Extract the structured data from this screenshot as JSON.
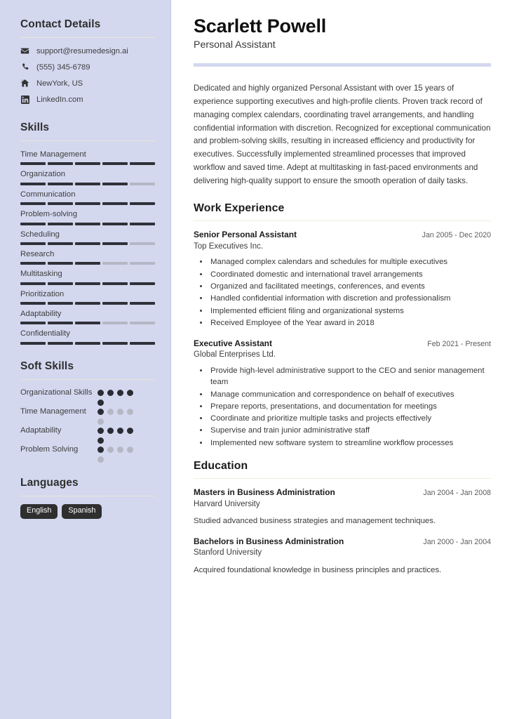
{
  "sidebar": {
    "contact": {
      "heading": "Contact Details",
      "items": [
        {
          "icon": "envelope-icon",
          "text": "support@resumedesign.ai"
        },
        {
          "icon": "phone-icon",
          "text": "(555) 345-6789"
        },
        {
          "icon": "home-icon",
          "text": "NewYork, US"
        },
        {
          "icon": "linkedin-icon",
          "text": "LinkedIn.com"
        }
      ]
    },
    "skills": {
      "heading": "Skills",
      "max": 5,
      "items": [
        {
          "name": "Time Management",
          "level": 5
        },
        {
          "name": "Organization",
          "level": 4
        },
        {
          "name": "Communication",
          "level": 5
        },
        {
          "name": "Problem-solving",
          "level": 5
        },
        {
          "name": "Scheduling",
          "level": 4
        },
        {
          "name": "Research",
          "level": 3
        },
        {
          "name": "Multitasking",
          "level": 5
        },
        {
          "name": "Prioritization",
          "level": 5
        },
        {
          "name": "Adaptability",
          "level": 3
        },
        {
          "name": "Confidentiality",
          "level": 5
        }
      ]
    },
    "soft_skills": {
      "heading": "Soft Skills",
      "max": 5,
      "items": [
        {
          "name": "Organizational Skills",
          "level": 5
        },
        {
          "name": "Time Management",
          "level": 1
        },
        {
          "name": "Adaptability",
          "level": 5
        },
        {
          "name": "Problem Solving",
          "level": 1
        }
      ]
    },
    "languages": {
      "heading": "Languages",
      "items": [
        "English",
        "Spanish"
      ]
    }
  },
  "main": {
    "name": "Scarlett Powell",
    "title": "Personal Assistant",
    "summary": "Dedicated and highly organized Personal Assistant with over 15 years of experience supporting executives and high-profile clients. Proven track record of managing complex calendars, coordinating travel arrangements, and handling confidential information with discretion. Recognized for exceptional communication and problem-solving skills, resulting in increased efficiency and productivity for executives. Successfully implemented streamlined processes that improved workflow and saved time. Adept at multitasking in fast-paced environments and delivering high-quality support to ensure the smooth operation of daily tasks.",
    "work": {
      "heading": "Work Experience",
      "entries": [
        {
          "role": "Senior Personal Assistant",
          "org": "Top Executives Inc.",
          "date": "Jan 2005 - Dec 2020",
          "bullets": [
            "Managed complex calendars and schedules for multiple executives",
            "Coordinated domestic and international travel arrangements",
            "Organized and facilitated meetings, conferences, and events",
            "Handled confidential information with discretion and professionalism",
            "Implemented efficient filing and organizational systems",
            "Received Employee of the Year award in 2018"
          ]
        },
        {
          "role": "Executive Assistant",
          "org": "Global Enterprises Ltd.",
          "date": "Feb 2021 - Present",
          "bullets": [
            "Provide high-level administrative support to the CEO and senior management team",
            "Manage communication and correspondence on behalf of executives",
            "Prepare reports, presentations, and documentation for meetings",
            "Coordinate and prioritize multiple tasks and projects effectively",
            "Supervise and train junior administrative staff",
            "Implemented new software system to streamline workflow processes"
          ]
        }
      ]
    },
    "education": {
      "heading": "Education",
      "entries": [
        {
          "degree": "Masters in Business Administration",
          "school": "Harvard University",
          "date": "Jan 2004 - Jan 2008",
          "description": "Studied advanced business strategies and management techniques."
        },
        {
          "degree": "Bachelors in Business Administration",
          "school": "Stanford University",
          "date": "Jan 2000 - Jan 2004",
          "description": "Acquired foundational knowledge in business principles and practices."
        }
      ]
    }
  },
  "colors": {
    "sidebar_bg": "#d3d8ef",
    "accent_bar": "#d3d8ef",
    "filled": "#2f3138",
    "empty": "#b4b7c4",
    "badge_bg": "#2f2f2f"
  }
}
